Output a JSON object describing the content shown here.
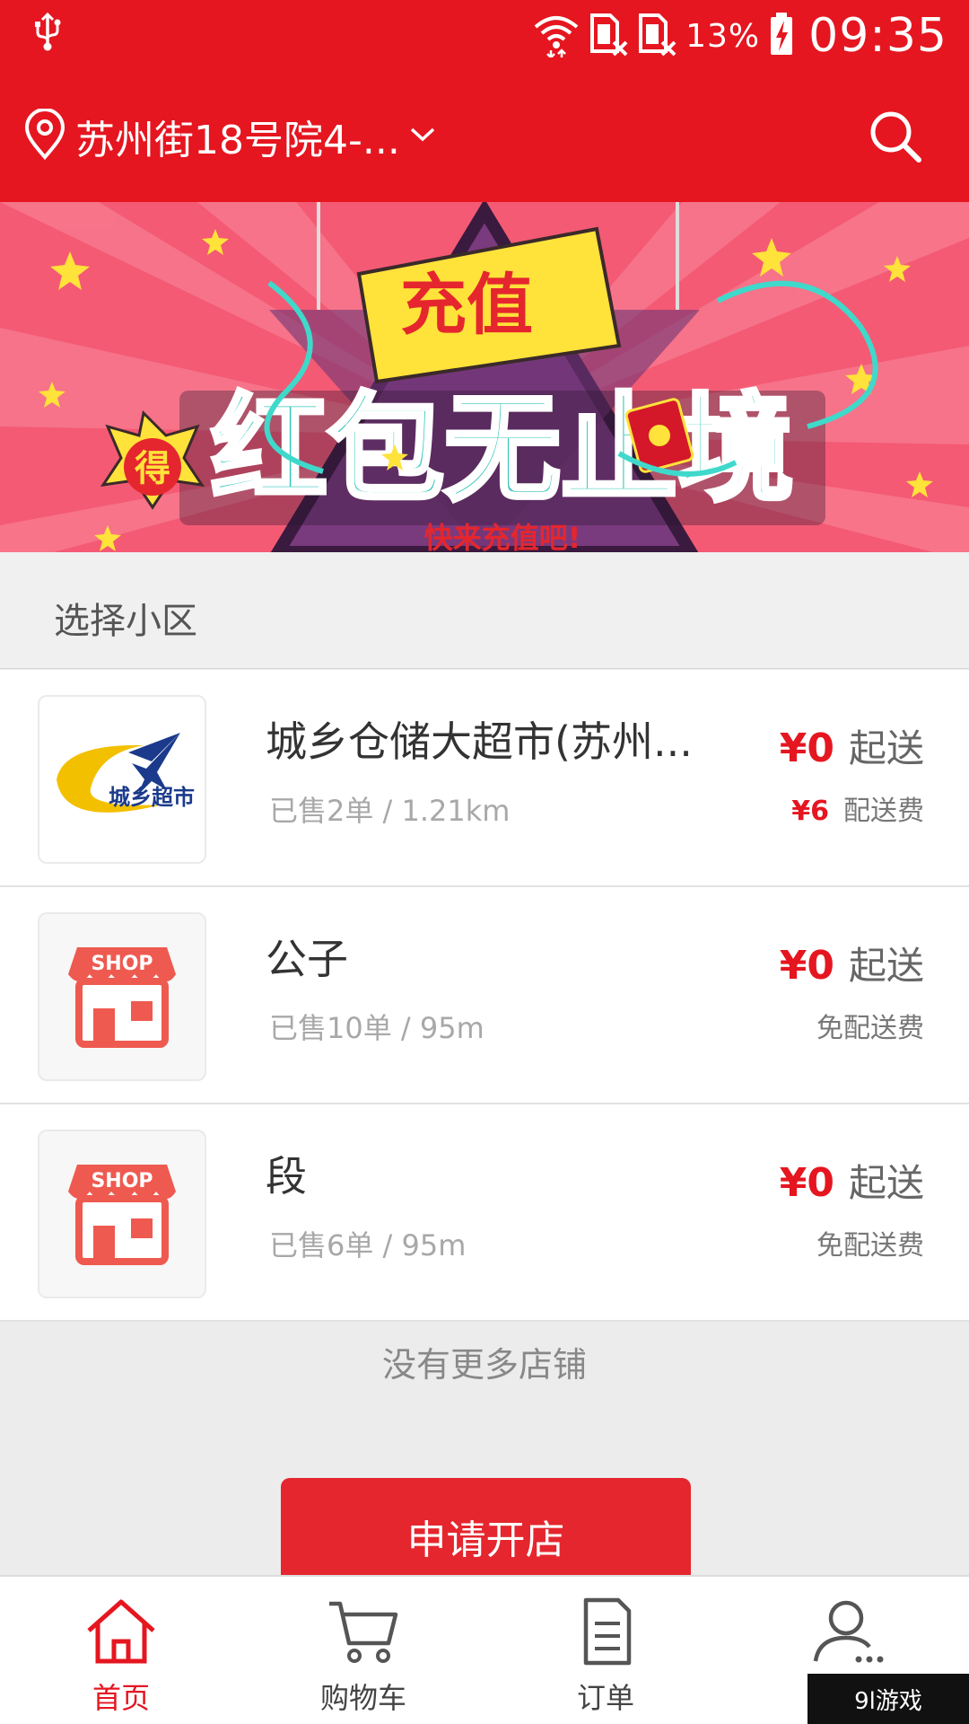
{
  "status_bar": {
    "battery_percent": "13%",
    "time": "09:35"
  },
  "header": {
    "location": "苏州街18号院4-...",
    "icons": [
      "location-pin-icon",
      "chevron-down-icon",
      "search-icon"
    ]
  },
  "banner": {
    "title_top": "充值",
    "badge": "得",
    "headline": "红包无止境",
    "tagline": "快来充值吧!"
  },
  "section": {
    "title": "选择小区"
  },
  "shops": [
    {
      "name": "城乡仓储大超市(苏州...",
      "meta": "已售2单 / 1.21km",
      "min_price": "¥0",
      "min_label": "起送",
      "fee": "¥6",
      "fee_label": "配送费",
      "logo_text": "城乡超市"
    },
    {
      "name": "公子",
      "meta": "已售10单 / 95m",
      "min_price": "¥0",
      "min_label": "起送",
      "fee_label": "免配送费",
      "logo_text": "SHOP"
    },
    {
      "name": "段",
      "meta": "已售6单 / 95m",
      "min_price": "¥0",
      "min_label": "起送",
      "fee_label": "免配送费",
      "logo_text": "SHOP"
    }
  ],
  "no_more": "没有更多店铺",
  "apply_button": "申请开店",
  "nav": [
    {
      "label": "首页",
      "icon": "home-icon",
      "active": true
    },
    {
      "label": "购物车",
      "icon": "cart-icon",
      "active": false
    },
    {
      "label": "订单",
      "icon": "order-icon",
      "active": false
    },
    {
      "label": "",
      "icon": "profile-icon",
      "active": false
    }
  ],
  "watermark": "9l游戏",
  "colors": {
    "primary": "#e51620",
    "banner_bg": "#f45a74",
    "headline": "#2fc5b8",
    "star": "#ffe23a"
  }
}
